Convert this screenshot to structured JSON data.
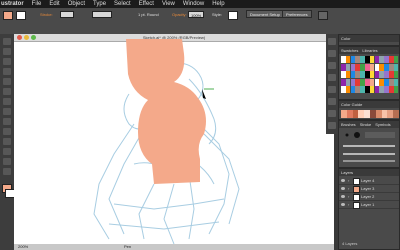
{
  "menubar": {
    "app": "ustrator",
    "items": [
      "File",
      "Edit",
      "Object",
      "Type",
      "Select",
      "Effect",
      "View",
      "Window",
      "Help"
    ]
  },
  "control": {
    "stroke_label": "Stroke:",
    "stroke_value": "1 pt. Round",
    "opacity_label": "Opacity:",
    "opacity_value": "100%",
    "style_label": "Style:",
    "doc_setup": "Document Setup",
    "preferences": "Preferences"
  },
  "document": {
    "title": "Sketch.ai* @ 200% (RGB/Preview)"
  },
  "status": {
    "zoom": "200%",
    "tool": "Pen"
  },
  "panels": {
    "color": {
      "tabs": [
        "Color"
      ]
    },
    "swatches": {
      "tabs": [
        "Swatches",
        "Libraries"
      ]
    },
    "color_guide": {
      "tabs": [
        "Color Guide"
      ]
    },
    "brushes": {
      "tabs": [
        "Brushes",
        "Stroke",
        "Symbols"
      ]
    },
    "layers": {
      "title": "Layers",
      "rows": [
        {
          "name": "Layer 4"
        },
        {
          "name": "Layer 3"
        },
        {
          "name": "Layer 2"
        },
        {
          "name": "Layer 1"
        }
      ],
      "count": "4 Layers"
    }
  },
  "colors": {
    "fill": "#f4a98a",
    "sketch": "#a8cde2",
    "accent": "#e78a3a"
  }
}
